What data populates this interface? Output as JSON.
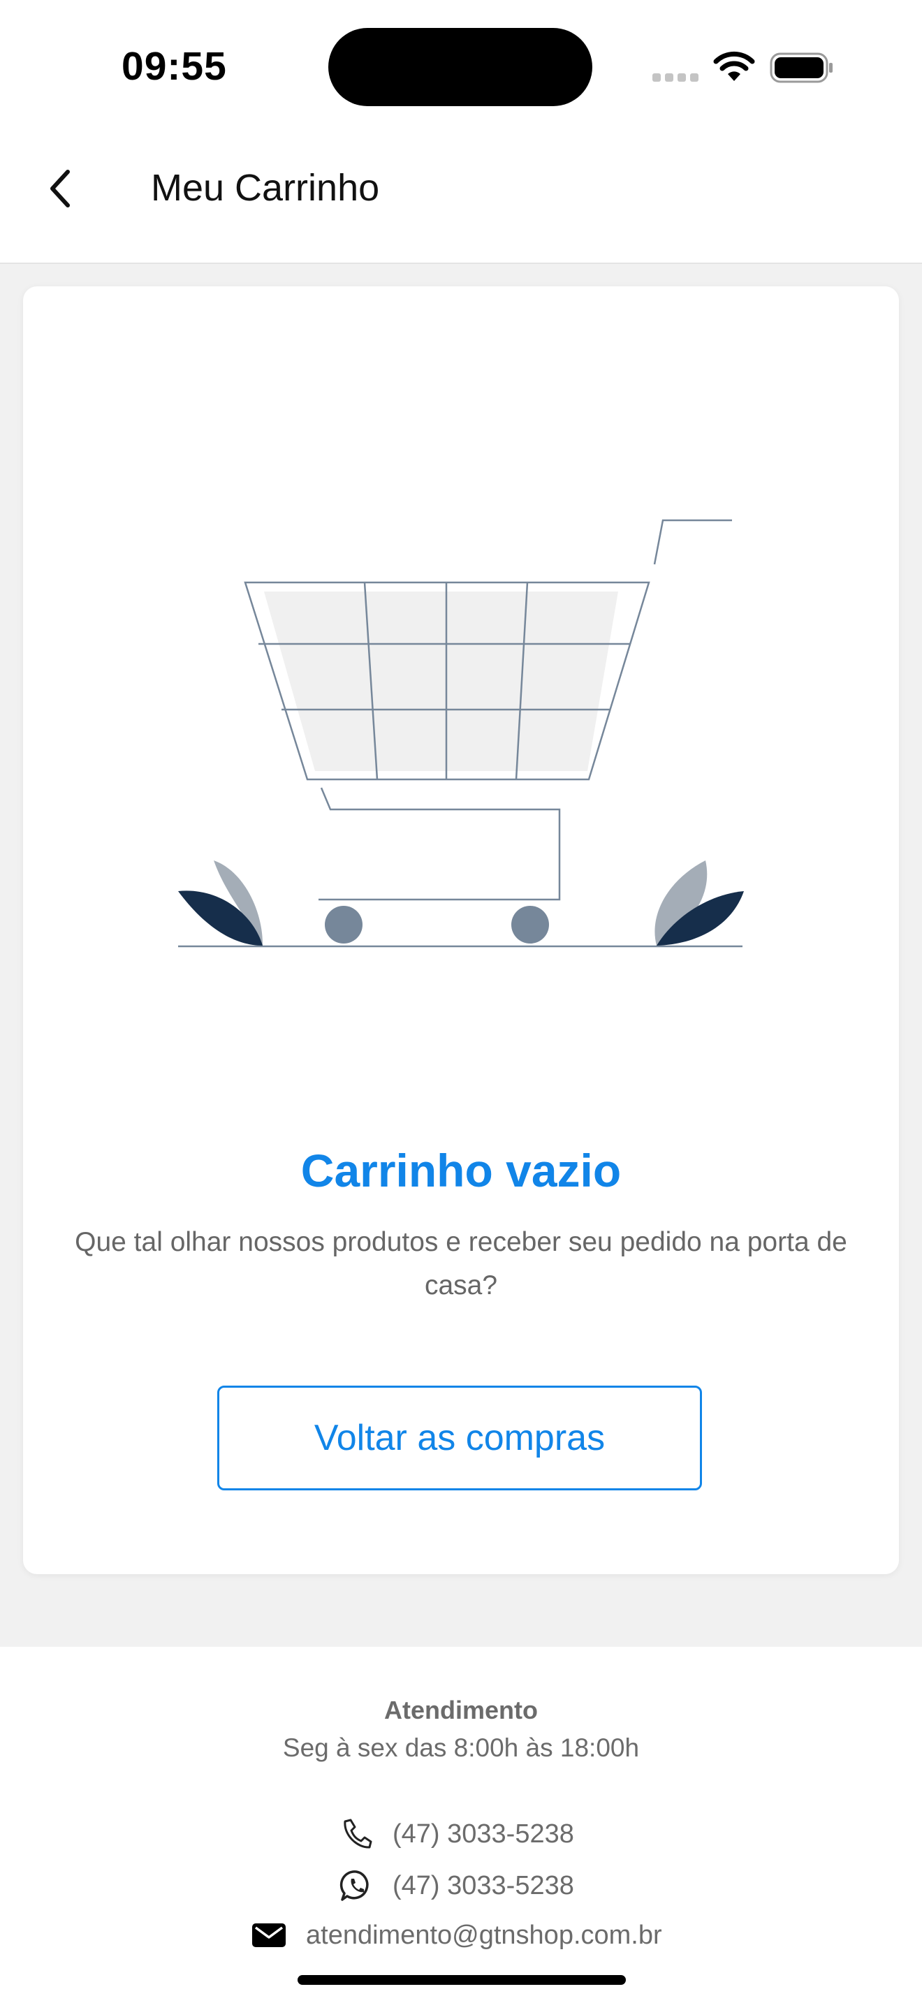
{
  "status_bar": {
    "time": "09:55"
  },
  "header": {
    "back_icon": "chevron-left-icon",
    "title": "Meu Carrinho"
  },
  "empty_state": {
    "illustration": "shopping-cart-illustration",
    "title": "Carrinho vazio",
    "description": "Que tal olhar nossos produtos e receber seu pedido na porta de casa?",
    "button_label": "Voltar as compras"
  },
  "footer": {
    "title": "Atendimento",
    "hours": "Seg à sex das 8:00h às 18:00h",
    "contacts": [
      {
        "icon": "phone-icon",
        "text": "(47) 3033-5238"
      },
      {
        "icon": "whatsapp-icon",
        "text": "(47) 3033-5238"
      },
      {
        "icon": "email-icon",
        "text": "atendimento@gtnshop.com.br"
      }
    ]
  },
  "colors": {
    "accent": "#1185e8",
    "text_muted": "#6b6b6b",
    "background": "#f1f1f1",
    "illustration_dark": "#162e4b",
    "illustration_mid": "#76879a"
  }
}
